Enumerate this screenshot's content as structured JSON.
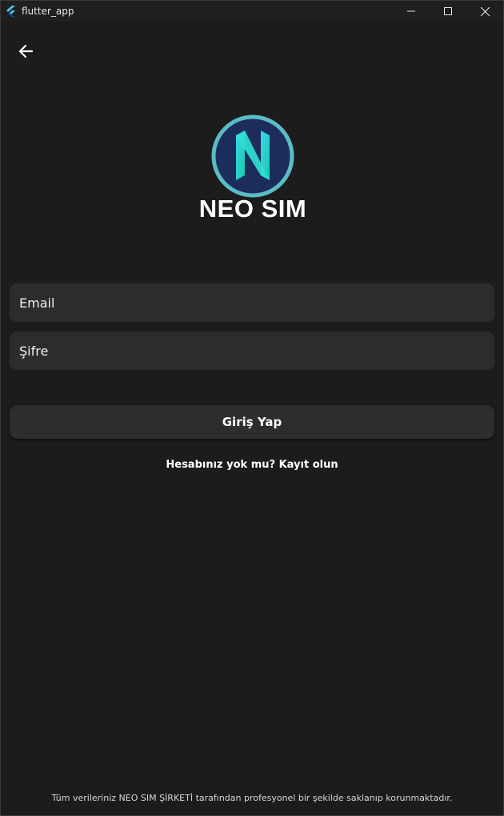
{
  "window": {
    "title": "flutter_app",
    "app_icon": "flutter-icon",
    "controls": [
      "minimize-icon",
      "maximize-icon",
      "close-icon"
    ]
  },
  "appbar": {
    "back_icon": "arrow-left-icon"
  },
  "logo": {
    "text": "NEO SIM",
    "ring_color": "#5bbcc4",
    "inner_color": "#1c2d5c",
    "letter_color": "#22d3c5"
  },
  "form": {
    "email_placeholder": "Email",
    "password_placeholder": "Şifre",
    "login_label": "Giriş Yap",
    "register_text": "Hesabınız yok mu? Kayıt olun"
  },
  "footer": {
    "text": "Tüm verileriniz NEO SIM ŞİRKETİ tarafından profesyonel bir şekilde saklanıp korunmaktadır."
  },
  "colors": {
    "background": "#1c1c1c",
    "field_bg": "#2c2c2c",
    "button_bg": "#2d2d2d",
    "text": "#ffffff"
  }
}
